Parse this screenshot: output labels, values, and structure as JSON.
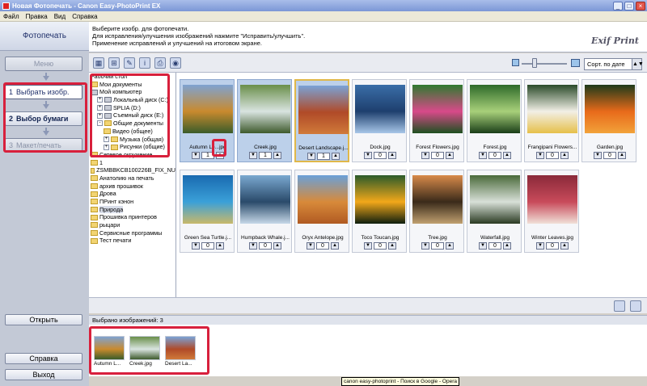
{
  "window": {
    "title": "Новая Фотопечать - Canon Easy-PhotoPrint EX",
    "minimize": "_",
    "maximize": "□",
    "close": "×"
  },
  "menu": [
    "Файл",
    "Правка",
    "Вид",
    "Справка"
  ],
  "left": {
    "header": "Фотопечать",
    "menu_button": "Меню",
    "step1_num": "1",
    "step1_label": "Выбрать изобр.",
    "step2_num": "2",
    "step2_label": "Выбор бумаги",
    "step3_num": "3",
    "step3_label": "Макет/печать",
    "open_button": "Открыть",
    "help_button": "Справка",
    "exit_button": "Выход"
  },
  "instructions": {
    "line1": "Выберите изобр. для фотопечати.",
    "line2": "Для исправления/улучшения изображений нажмите \"Исправить/улучшить\".",
    "line3": "Применение исправлений и улучшений на итоговом экране.",
    "logo": "Exif Print"
  },
  "toolbar": {
    "icons": [
      "select-all-icon",
      "grid-view-icon",
      "correct-icon",
      "info-icon",
      "print-icon",
      "web-icon"
    ],
    "sort_value": "Сорт. по дате",
    "sort_arrow": "▲▼"
  },
  "tree": [
    {
      "label": "Рабочий стол",
      "type": "none",
      "indent": 0
    },
    {
      "label": "Мои документы",
      "type": "folder",
      "indent": 0
    },
    {
      "label": "Мой компьютер",
      "type": "drive",
      "indent": 0
    },
    {
      "label": "Локальный диск (C:)",
      "type": "drive",
      "indent": 1,
      "expand": "+"
    },
    {
      "label": "SPLIA (D:)",
      "type": "drive",
      "indent": 1,
      "expand": "+"
    },
    {
      "label": "Съемный диск (E:)",
      "type": "drive",
      "indent": 1,
      "expand": "+"
    },
    {
      "label": "Общие документы",
      "type": "folder",
      "indent": 1,
      "expand": "-"
    },
    {
      "label": "Видео (общее)",
      "type": "folder",
      "indent": 2
    },
    {
      "label": "Музыка (общая)",
      "type": "folder",
      "indent": 2,
      "expand": "+"
    },
    {
      "label": "Рисунки (общие)",
      "type": "folder",
      "indent": 2,
      "expand": "+"
    },
    {
      "label": "Сетевое окружение",
      "type": "folder",
      "indent": 0
    },
    {
      "label": "1",
      "type": "folder",
      "indent": 0
    },
    {
      "label": "ZSMBBKCB100226B_FIX_NU",
      "type": "folder",
      "indent": 0
    },
    {
      "label": "Анатолию на печать",
      "type": "folder",
      "indent": 0
    },
    {
      "label": "архив прошивок",
      "type": "folder",
      "indent": 0
    },
    {
      "label": "Дрова",
      "type": "folder",
      "indent": 0
    },
    {
      "label": "ПРинт кэнон",
      "type": "folder",
      "indent": 0
    },
    {
      "label": "Природа",
      "type": "folder",
      "indent": 0,
      "selected": true
    },
    {
      "label": "Прошивка принтеров",
      "type": "folder",
      "indent": 0
    },
    {
      "label": "рыцари",
      "type": "folder",
      "indent": 0
    },
    {
      "label": "Сервисные программы",
      "type": "folder",
      "indent": 0
    },
    {
      "label": "Тест печати",
      "type": "folder",
      "indent": 0
    }
  ],
  "thumbnails": [
    {
      "name": "Autumn Le...jpg",
      "count": "1",
      "selected": true,
      "colors": [
        "#7fa3d1",
        "#c98a2e",
        "#3a5c2a"
      ]
    },
    {
      "name": "Creek.jpg",
      "count": "1",
      "selected": true,
      "colors": [
        "#6a8f4a",
        "#d9e4e0",
        "#3e5a2c"
      ]
    },
    {
      "name": "Desert Landscape.j...",
      "count": "1",
      "selected": true,
      "focus": true,
      "colors": [
        "#7aa2d6",
        "#b04a28",
        "#d07a3a"
      ]
    },
    {
      "name": "Dock.jpg",
      "count": "0",
      "colors": [
        "#3a6ea8",
        "#1e3f6e",
        "#a8c6e8"
      ]
    },
    {
      "name": "Forest Flowers.jpg",
      "count": "0",
      "colors": [
        "#2f7a2f",
        "#d84a8a",
        "#1e5020"
      ]
    },
    {
      "name": "Forest.jpg",
      "count": "0",
      "colors": [
        "#2e6a2a",
        "#a8d07a",
        "#1a3e18"
      ]
    },
    {
      "name": "Frangipani Flowers...",
      "count": "0",
      "colors": [
        "#2a4a2a",
        "#f2efe6",
        "#e6c04a"
      ]
    },
    {
      "name": "Garden.jpg",
      "count": "0",
      "colors": [
        "#1e3a1a",
        "#e86a1a",
        "#f2a23a"
      ]
    },
    {
      "name": "Green Sea Turtle.j...",
      "count": "0",
      "colors": [
        "#1a6ab0",
        "#3aa0d8",
        "#c8b86a"
      ]
    },
    {
      "name": "Humpback Whale.j...",
      "count": "0",
      "colors": [
        "#7aa8d0",
        "#2a4a6a",
        "#c6d8e8"
      ]
    },
    {
      "name": "Oryx Antelope.jpg",
      "count": "0",
      "colors": [
        "#6aa0d8",
        "#d88a3a",
        "#b05a22"
      ]
    },
    {
      "name": "Toco Toucan.jpg",
      "count": "0",
      "colors": [
        "#2a5a2a",
        "#f2a81a",
        "#0e1e0e"
      ]
    },
    {
      "name": "Tree.jpg",
      "count": "0",
      "colors": [
        "#d88a4a",
        "#3a2a1a",
        "#c0a070"
      ]
    },
    {
      "name": "Waterfall.jpg",
      "count": "0",
      "colors": [
        "#4a6a3a",
        "#d8e0d8",
        "#2a3a22"
      ]
    },
    {
      "name": "Winter Leaves.jpg",
      "count": "0",
      "colors": [
        "#8a2a3a",
        "#c84a5a",
        "#f0e0d8"
      ]
    }
  ],
  "selected_label": "Выбрано изображений: 3",
  "tray": [
    {
      "name": "Autumn L...",
      "colors": [
        "#7fa3d1",
        "#c98a2e",
        "#3a5c2a"
      ]
    },
    {
      "name": "Creek.jpg",
      "colors": [
        "#6a8f4a",
        "#d9e4e0",
        "#3e5a2c"
      ]
    },
    {
      "name": "Desert La...",
      "colors": [
        "#7aa2d6",
        "#b04a28",
        "#d07a3a"
      ]
    }
  ],
  "tooltip": "canon easy-photoprint - Поиск в Google - Opera",
  "accents": {
    "highlight_red": "#d8203c",
    "title_blue": "#7b97d6",
    "focus_gold": "#e0b84a"
  }
}
